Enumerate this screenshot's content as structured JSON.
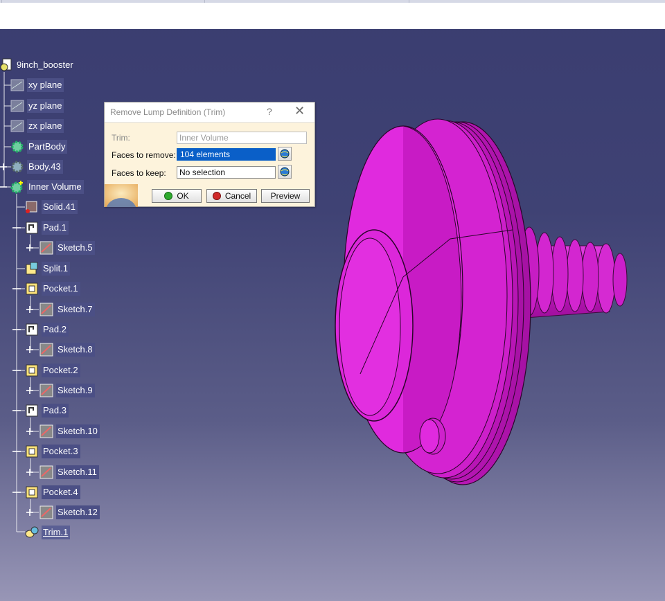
{
  "tree": {
    "root": "9inch_booster",
    "items": [
      {
        "label": "xy plane"
      },
      {
        "label": "yz plane"
      },
      {
        "label": "zx plane"
      },
      {
        "label": "PartBody"
      },
      {
        "label": "Body.43"
      },
      {
        "label": "Inner Volume"
      },
      {
        "label": "Solid.41"
      },
      {
        "label": "Pad.1"
      },
      {
        "label": "Sketch.5"
      },
      {
        "label": "Split.1"
      },
      {
        "label": "Pocket.1"
      },
      {
        "label": "Sketch.7"
      },
      {
        "label": "Pad.2"
      },
      {
        "label": "Sketch.8"
      },
      {
        "label": "Pocket.2"
      },
      {
        "label": "Sketch.9"
      },
      {
        "label": "Pad.3"
      },
      {
        "label": "Sketch.10"
      },
      {
        "label": "Pocket.3"
      },
      {
        "label": "Sketch.11"
      },
      {
        "label": "Pocket.4"
      },
      {
        "label": "Sketch.12"
      },
      {
        "label": "Trim.1"
      }
    ]
  },
  "dialog": {
    "title": "Remove Lump Definition (Trim)",
    "help": "?",
    "close": "✕",
    "trim_label": "Trim:",
    "trim_value": "Inner Volume",
    "faces_remove_label": "Faces to remove:",
    "faces_remove_value": "104 elements",
    "faces_keep_label": "Faces to keep:",
    "faces_keep_value": "No selection",
    "ok": "OK",
    "cancel": "Cancel",
    "preview": "Preview"
  },
  "colors": {
    "model": "#d81bd0",
    "ok_dot": "#2eaa2e",
    "cancel_dot": "#d02a2a",
    "selection": "#0a5fc8"
  },
  "icons": {
    "selector": "selection-globe-icon"
  }
}
